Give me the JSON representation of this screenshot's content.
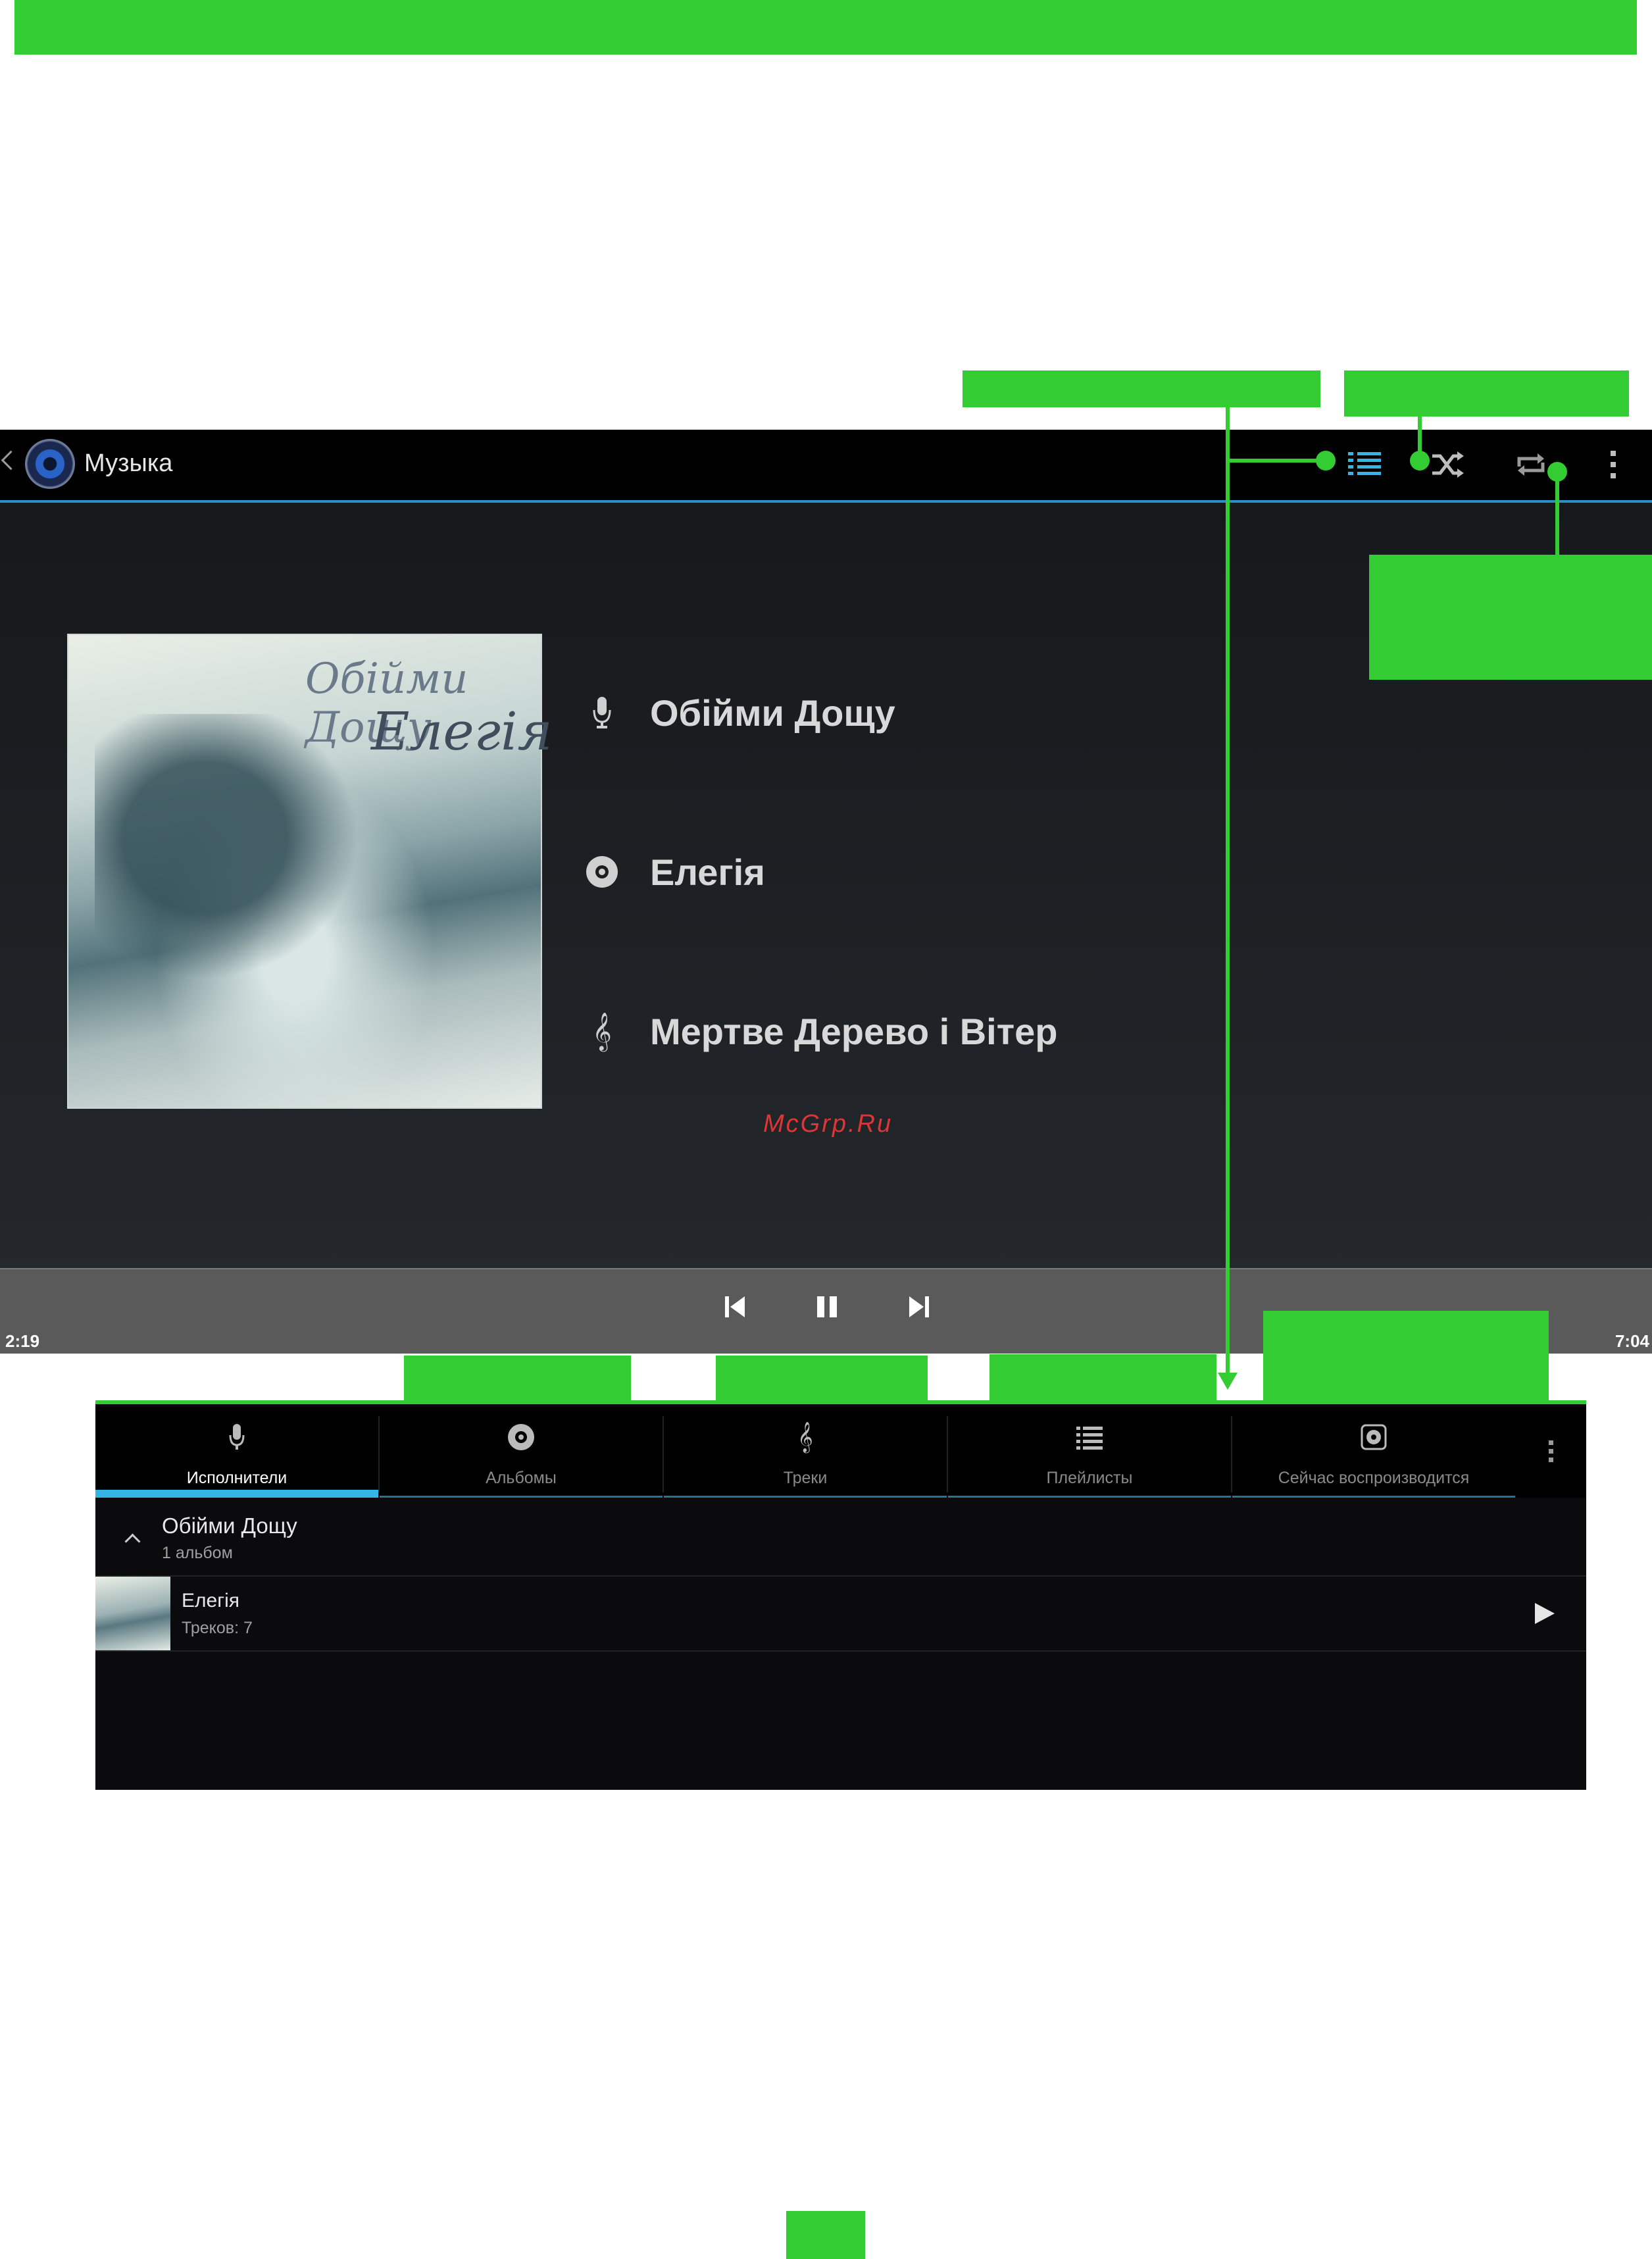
{
  "colors": {
    "annotation_green": "#33cc33",
    "accent_blue": "#33b5e5",
    "actionbar_line": "#2a8fc5"
  },
  "player": {
    "actionbar": {
      "title": "Музыка",
      "icons": [
        "back-chevron-icon",
        "music-app-icon",
        "now-playing-list-icon",
        "shuffle-icon",
        "repeat-icon",
        "overflow-menu-icon"
      ]
    },
    "track": {
      "artist": "Обійми Дощу",
      "album": "Елегія",
      "title": "Мертве Дерево і Вітер"
    },
    "album_art": {
      "line1": "Обійми Дощу",
      "line2": "Елегія"
    },
    "watermark": "McGrp.Ru",
    "controls": {
      "elapsed": "2:19",
      "total": "7:04",
      "icons": [
        "previous-icon",
        "pause-icon",
        "next-icon"
      ]
    }
  },
  "library": {
    "tabs": [
      {
        "label": "Исполнители",
        "icon": "microphone-icon",
        "active": true
      },
      {
        "label": "Альбомы",
        "icon": "disc-icon",
        "active": false
      },
      {
        "label": "Треки",
        "icon": "treble-clef-icon",
        "active": false
      },
      {
        "label": "Плейлисты",
        "icon": "playlist-icon",
        "active": false
      },
      {
        "label": "Сейчас воспроизводится",
        "icon": "now-playing-icon",
        "active": false
      }
    ],
    "artist": {
      "name": "Обійми Дощу",
      "count": "1 альбом"
    },
    "album": {
      "name": "Елегія",
      "tracks": "Треков: 7"
    }
  }
}
